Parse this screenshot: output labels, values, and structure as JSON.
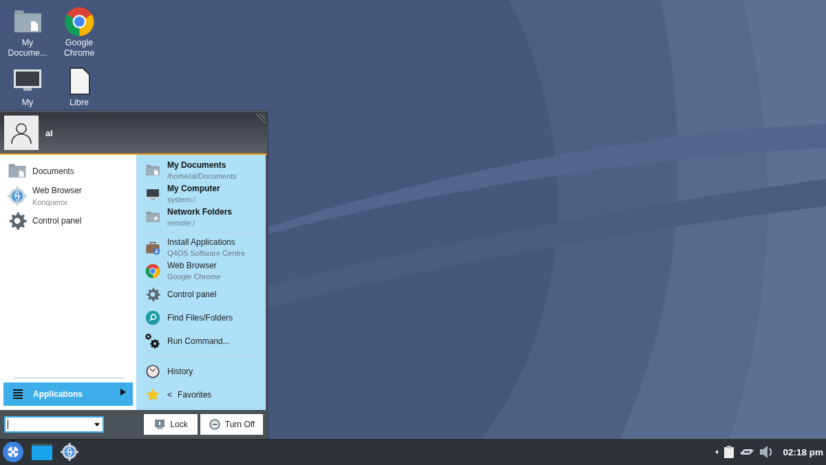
{
  "desktop_icons": [
    {
      "label": "My Docume..."
    },
    {
      "label": "Google Chrome"
    },
    {
      "label": "My"
    },
    {
      "label": "Libre"
    }
  ],
  "menu": {
    "user": {
      "name": "al"
    },
    "favorites": [
      {
        "title": "Documents"
      },
      {
        "title": "Web Browser",
        "subtitle": "Konqueror"
      },
      {
        "title": "Control panel"
      }
    ],
    "applications_button": {
      "label": "Applications",
      "selected": true
    },
    "right_panel": {
      "groups": [
        [
          {
            "kind": "place",
            "title": "My Documents",
            "subtitle": "/home/al/Documents"
          },
          {
            "kind": "place",
            "title": "My Computer",
            "subtitle": "system:/"
          },
          {
            "kind": "place",
            "title": "Network Folders",
            "subtitle": "remote:/"
          }
        ],
        [
          {
            "kind": "app",
            "title": "Install Applications",
            "subtitle": "Q4OS Software Centre"
          },
          {
            "kind": "app",
            "title": "Web Browser",
            "subtitle": "Google Chrome"
          },
          {
            "kind": "app",
            "title": "Control panel"
          },
          {
            "kind": "app",
            "title": "Find Files/Folders"
          },
          {
            "kind": "app",
            "title": "Run Command..."
          }
        ],
        [
          {
            "kind": "app",
            "title": "History"
          },
          {
            "kind": "app",
            "title": "Favorites",
            "arrow": "<"
          }
        ]
      ]
    },
    "buttons": [
      {
        "label": "Lock"
      },
      {
        "label": "Turn Off"
      }
    ]
  },
  "taskbar": {
    "clock": "02:18 pm"
  }
}
